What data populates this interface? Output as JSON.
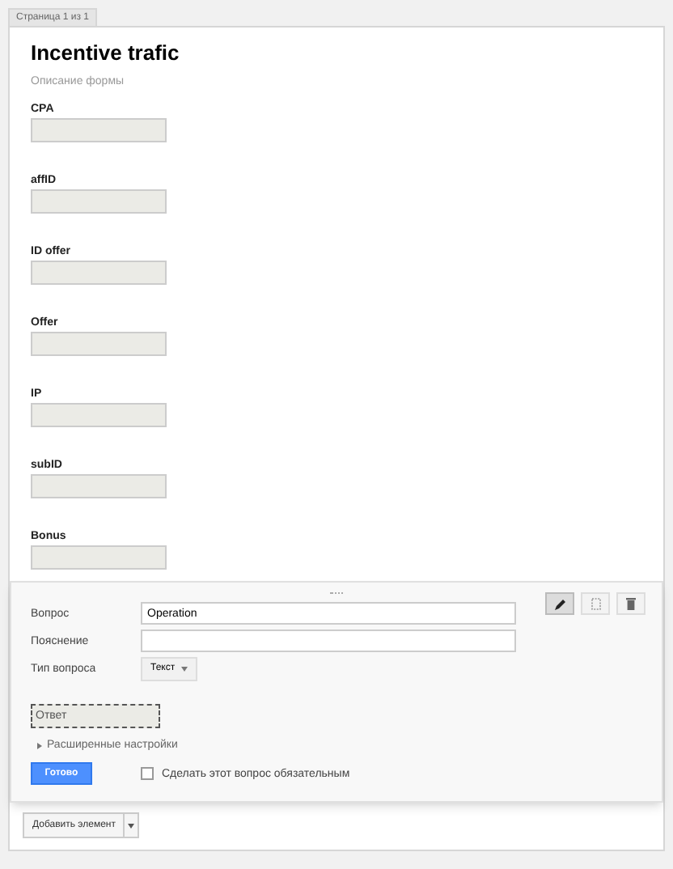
{
  "page_tab": "Страница 1 из 1",
  "form": {
    "title": "Incentive trafic",
    "description": "Описание формы"
  },
  "questions": [
    {
      "label": "CPA"
    },
    {
      "label": "affID"
    },
    {
      "label": "ID offer"
    },
    {
      "label": "Offer"
    },
    {
      "label": "IP"
    },
    {
      "label": "subID"
    },
    {
      "label": "Bonus"
    }
  ],
  "editor": {
    "tools": [
      {
        "kind": "edit",
        "selected": true
      },
      {
        "kind": "copy",
        "selected": false
      },
      {
        "kind": "delete",
        "selected": false
      }
    ],
    "question_label": "Вопрос",
    "question_value": "Operation",
    "hint_label": "Пояснение",
    "type_label": "Тип вопроса",
    "type_value": "Текст",
    "answer_placeholder": "Ответ",
    "advanced": {
      "label": "Расширенные настройки",
      "expanded": false
    },
    "done": "Готово",
    "required": {
      "label": "Сделать этот вопрос обязательным",
      "checked": false
    }
  },
  "add_item": "Добавить элемент"
}
